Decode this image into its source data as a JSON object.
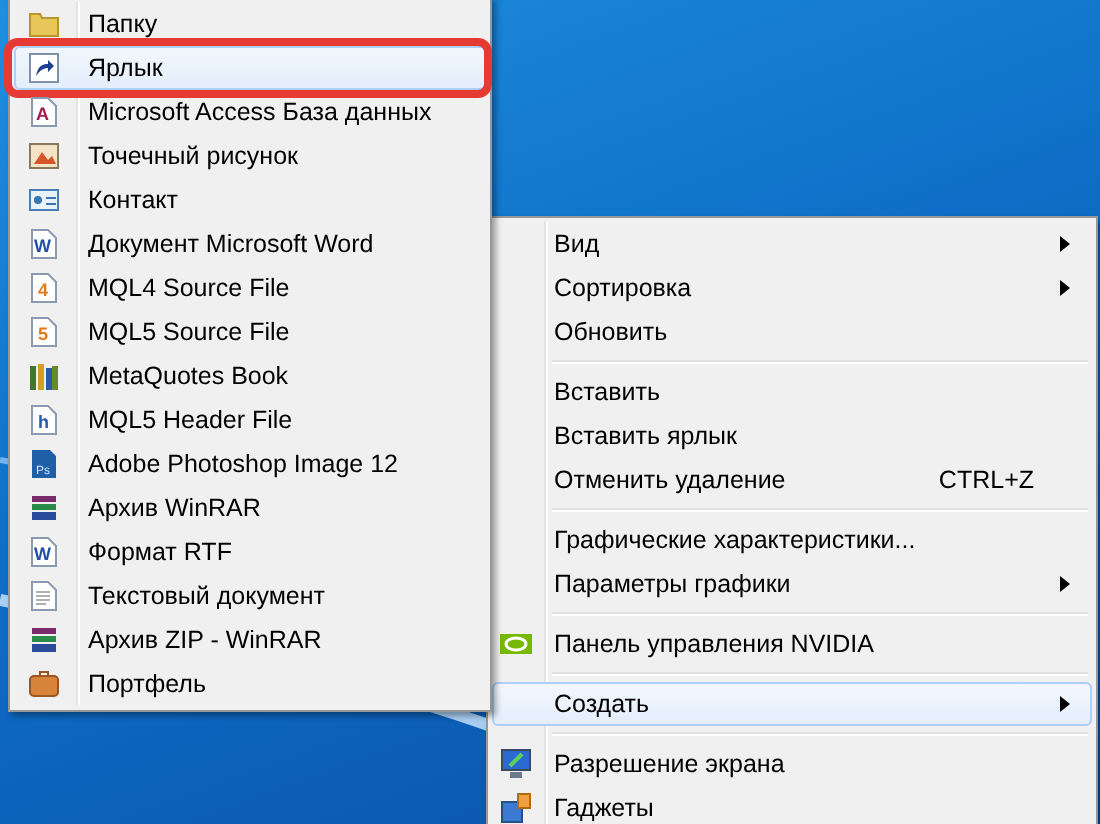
{
  "submenu": {
    "items": [
      {
        "label": "Папку",
        "kind": "folder",
        "selected": false,
        "circled": false
      },
      {
        "label": "Ярлык",
        "kind": "shortcut",
        "selected": true,
        "circled": true
      },
      {
        "label": "Microsoft Access База данных",
        "kind": "database",
        "icon_text": "A",
        "selected": false,
        "circled": false
      },
      {
        "label": "Точечный рисунок",
        "kind": "image",
        "selected": false,
        "circled": false
      },
      {
        "label": "Контакт",
        "kind": "contact",
        "selected": false,
        "circled": false
      },
      {
        "label": "Документ Microsoft Word",
        "kind": "word",
        "icon_text": "W",
        "selected": false,
        "circled": false
      },
      {
        "label": "MQL4 Source File",
        "kind": "mql",
        "icon_text": "4",
        "selected": false,
        "circled": false
      },
      {
        "label": "MQL5 Source File",
        "kind": "mql",
        "icon_text": "5",
        "selected": false,
        "circled": false
      },
      {
        "label": "MetaQuotes Book",
        "kind": "book",
        "selected": false,
        "circled": false
      },
      {
        "label": "MQL5 Header File",
        "kind": "header",
        "icon_text": "h",
        "selected": false,
        "circled": false
      },
      {
        "label": "Adobe Photoshop Image 12",
        "kind": "photoshop",
        "icon_text": "Ps",
        "selected": false,
        "circled": false
      },
      {
        "label": "Архив WinRAR",
        "kind": "archive",
        "selected": false,
        "circled": false
      },
      {
        "label": "Формат RTF",
        "kind": "word",
        "icon_text": "W",
        "selected": false,
        "circled": false
      },
      {
        "label": "Текстовый документ",
        "kind": "text",
        "selected": false,
        "circled": false
      },
      {
        "label": "Архив ZIP - WinRAR",
        "kind": "archive",
        "selected": false,
        "circled": false
      },
      {
        "label": "Портфель",
        "kind": "briefcase",
        "selected": false,
        "circled": false
      }
    ]
  },
  "context_menu": {
    "groups": [
      [
        {
          "label": "Вид",
          "kind": "plain",
          "submenu": true,
          "selected": false
        },
        {
          "label": "Сортировка",
          "kind": "plain",
          "submenu": true,
          "selected": false
        },
        {
          "label": "Обновить",
          "kind": "plain",
          "submenu": false,
          "selected": false
        }
      ],
      [
        {
          "label": "Вставить",
          "kind": "plain",
          "submenu": false,
          "selected": false
        },
        {
          "label": "Вставить ярлык",
          "kind": "plain",
          "submenu": false,
          "selected": false
        },
        {
          "label": "Отменить удаление",
          "kind": "plain",
          "submenu": false,
          "selected": false,
          "shortcut": "CTRL+Z"
        }
      ],
      [
        {
          "label": "Графические характеристики...",
          "kind": "plain",
          "submenu": false,
          "selected": false
        },
        {
          "label": "Параметры графики",
          "kind": "plain",
          "submenu": true,
          "selected": false
        }
      ],
      [
        {
          "label": "Панель управления NVIDIA",
          "kind": "nvidia",
          "submenu": false,
          "selected": false
        }
      ],
      [
        {
          "label": "Создать",
          "kind": "plain",
          "submenu": true,
          "selected": true
        }
      ],
      [
        {
          "label": "Разрешение экрана",
          "kind": "display",
          "submenu": false,
          "selected": false
        },
        {
          "label": "Гаджеты",
          "kind": "gadgets",
          "submenu": false,
          "selected": false
        }
      ]
    ]
  }
}
